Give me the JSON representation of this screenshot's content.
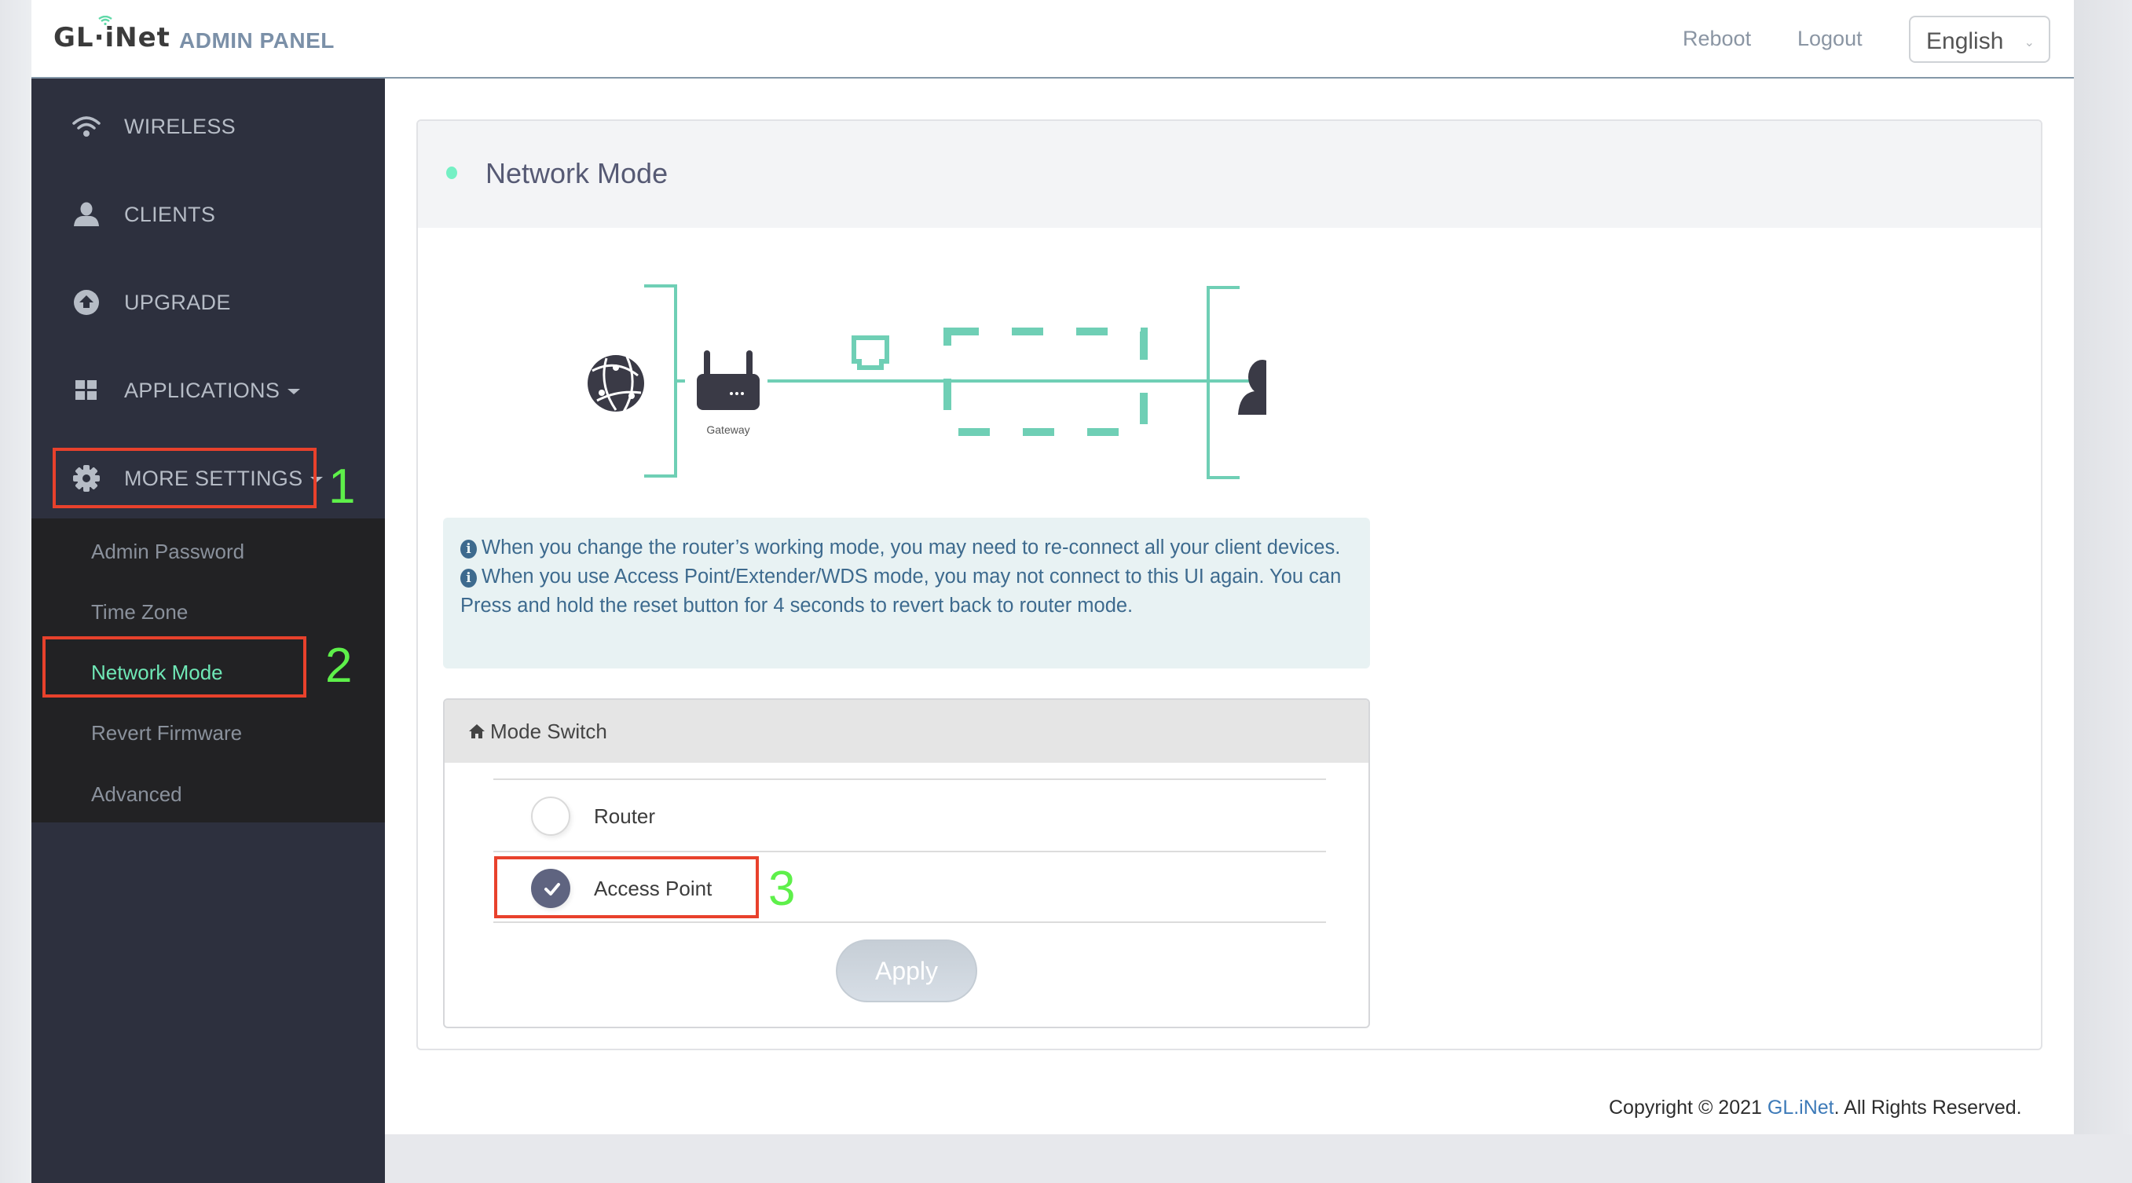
{
  "header": {
    "logo_text": "GL·iNet",
    "panel_title": "ADMIN PANEL",
    "reboot_label": "Reboot",
    "logout_label": "Logout",
    "language_selected": "English"
  },
  "sidebar": {
    "items": [
      {
        "label": "WIRELESS",
        "icon": "wifi-icon"
      },
      {
        "label": "CLIENTS",
        "icon": "user-icon"
      },
      {
        "label": "UPGRADE",
        "icon": "upload-circle-icon"
      },
      {
        "label": "APPLICATIONS",
        "icon": "grid-icon",
        "has_caret": true
      },
      {
        "label": "MORE SETTINGS",
        "icon": "gear-icon",
        "has_caret": true,
        "expanded": true
      }
    ],
    "submenu": [
      {
        "label": "Admin Password"
      },
      {
        "label": "Time Zone"
      },
      {
        "label": "Network Mode",
        "active": true
      },
      {
        "label": "Revert Firmware"
      },
      {
        "label": "Advanced"
      }
    ]
  },
  "annotations": [
    "1",
    "2",
    "3"
  ],
  "main": {
    "title": "Network Mode",
    "diagram": {
      "gateway_label": "Gateway"
    },
    "notices": [
      "When you change the router’s working mode, you may need to re-connect all your client devices.",
      "When you use Access Point/Extender/WDS mode, you may not connect to this UI again. You can Press and hold the reset button for 4 seconds to revert back to router mode."
    ],
    "mode_switch": {
      "title": "Mode Switch",
      "options": [
        {
          "label": "Router",
          "checked": false
        },
        {
          "label": "Access Point",
          "checked": true
        }
      ],
      "apply_label": "Apply"
    }
  },
  "footer": {
    "prefix": "Copyright © 2021 ",
    "link": "GL.iNet",
    "suffix": ". All Rights Reserved."
  },
  "colors": {
    "accent": "#74f0c4",
    "sidebar_bg": "#2d303e",
    "submenu_bg": "#222224",
    "active_item": "#6fe8b6",
    "notice_text": "#3d6a8e",
    "annotation_box": "#e8412c",
    "annotation_number": "#5ef04a"
  }
}
